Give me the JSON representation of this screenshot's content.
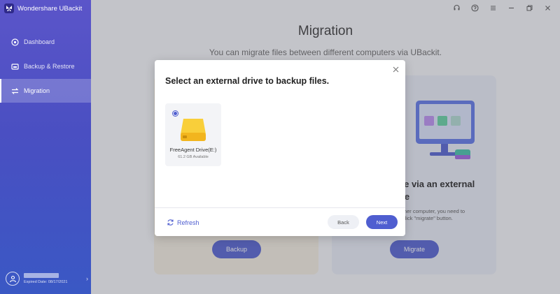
{
  "app": {
    "title": "Wondershare UBackit",
    "logo_icon": "butterfly-logo-icon"
  },
  "sidebar": {
    "items": [
      {
        "label": "Dashboard",
        "icon": "dashboard-icon"
      },
      {
        "label": "Backup & Restore",
        "icon": "backup-icon"
      },
      {
        "label": "Migration",
        "icon": "migration-icon",
        "active": true
      }
    ],
    "user": {
      "expire_text": "Expired Date: 08/17/2021"
    }
  },
  "window_controls": [
    "headset-icon",
    "help-icon",
    "menu-icon",
    "minimize-icon",
    "restore-icon",
    "close-icon"
  ],
  "main": {
    "title": "Migration",
    "subtitle": "You can migrate files between different computers via UBackit.",
    "cards": [
      {
        "button": "Backup"
      },
      {
        "title_line1": "o file via an external",
        "title_line2": "drive",
        "desc_line1": "to another computer, you need to",
        "desc_line2": "e and click \"migrate\" button.",
        "button": "Migrate"
      }
    ]
  },
  "dialog": {
    "title": "Select an external drive to backup files.",
    "drives": [
      {
        "name": "FreeAgent Drive(E:)",
        "available": "61.2 GB Available",
        "selected": true
      }
    ],
    "refresh_label": "Refresh",
    "back_label": "Back",
    "next_label": "Next"
  },
  "colors": {
    "accent": "#4f5ed0",
    "sidebar_top": "#5b55c9",
    "sidebar_bottom": "#3a58c4",
    "drive_yellow": "#f7c52a"
  }
}
